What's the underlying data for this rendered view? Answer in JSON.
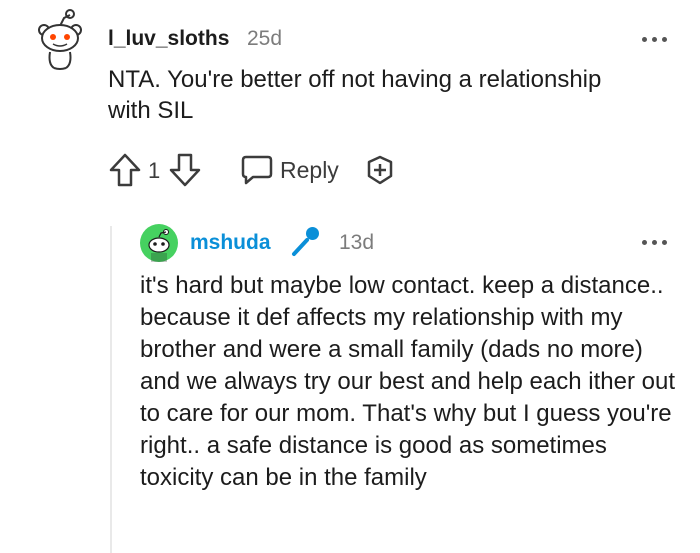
{
  "comment": {
    "author": "l_luv_sloths",
    "age": "25d",
    "text": "NTA. You're better off not having a relationship with SIL",
    "score": "1",
    "reply_label": "Reply",
    "avatar_icon": "snoo-avatar-icon",
    "more_icon": "more-options-icon"
  },
  "reply": {
    "author": "mshuda",
    "age": "13d",
    "text": "it's hard but maybe low contact. keep a distance.. because it def affects my relationship with my brother and were a small family (dads no more) and we always try our best and help each ither out to care for our mom. That's why but I guess you're right.. a safe distance is good as sometimes toxicity can be in the family",
    "avatar_icon": "green-snoo-avatar-icon",
    "flair_icon": "microphone-icon",
    "author_color": "#0a8fd8",
    "avatar_color": "#46d160"
  }
}
